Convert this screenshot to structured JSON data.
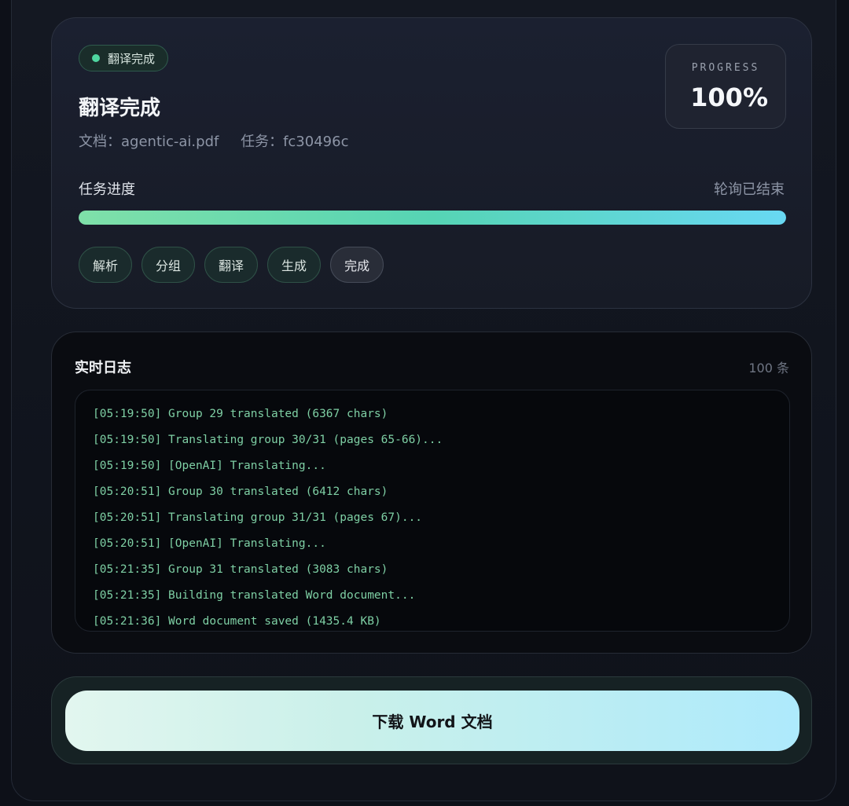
{
  "status": {
    "badge": "翻译完成",
    "title": "翻译完成",
    "document": "文档：agentic-ai.pdf",
    "task": "任务：fc30496c",
    "progress_label": "PROGRESS",
    "progress_value": "100%",
    "progress_fraction": 1.0,
    "section_label": "任务进度",
    "polling_state": "轮询已结束",
    "stages": [
      "解析",
      "分组",
      "翻译",
      "生成",
      "完成"
    ],
    "current_stage": "完成"
  },
  "log": {
    "title": "实时日志",
    "count": "100 条",
    "lines": [
      "[05:19:50] Group 29 translated (6367 chars)",
      "[05:19:50] Translating group 30/31 (pages 65-66)...",
      "[05:19:50] [OpenAI] Translating...",
      "[05:20:51] Group 30 translated (6412 chars)",
      "[05:20:51] Translating group 31/31 (pages 67)...",
      "[05:20:51] [OpenAI] Translating...",
      "[05:21:35] Group 31 translated (3083 chars)",
      "[05:21:35] Building translated Word document...",
      "[05:21:36] Word document saved (1435.4 KB)"
    ]
  },
  "action": {
    "download_label": "下载 Word 文档"
  },
  "colors": {
    "accent_green": "#4fd6a0",
    "log_text": "#7ecfa4",
    "progress_start": "#7fe0a9",
    "progress_end": "#68d8f3"
  }
}
